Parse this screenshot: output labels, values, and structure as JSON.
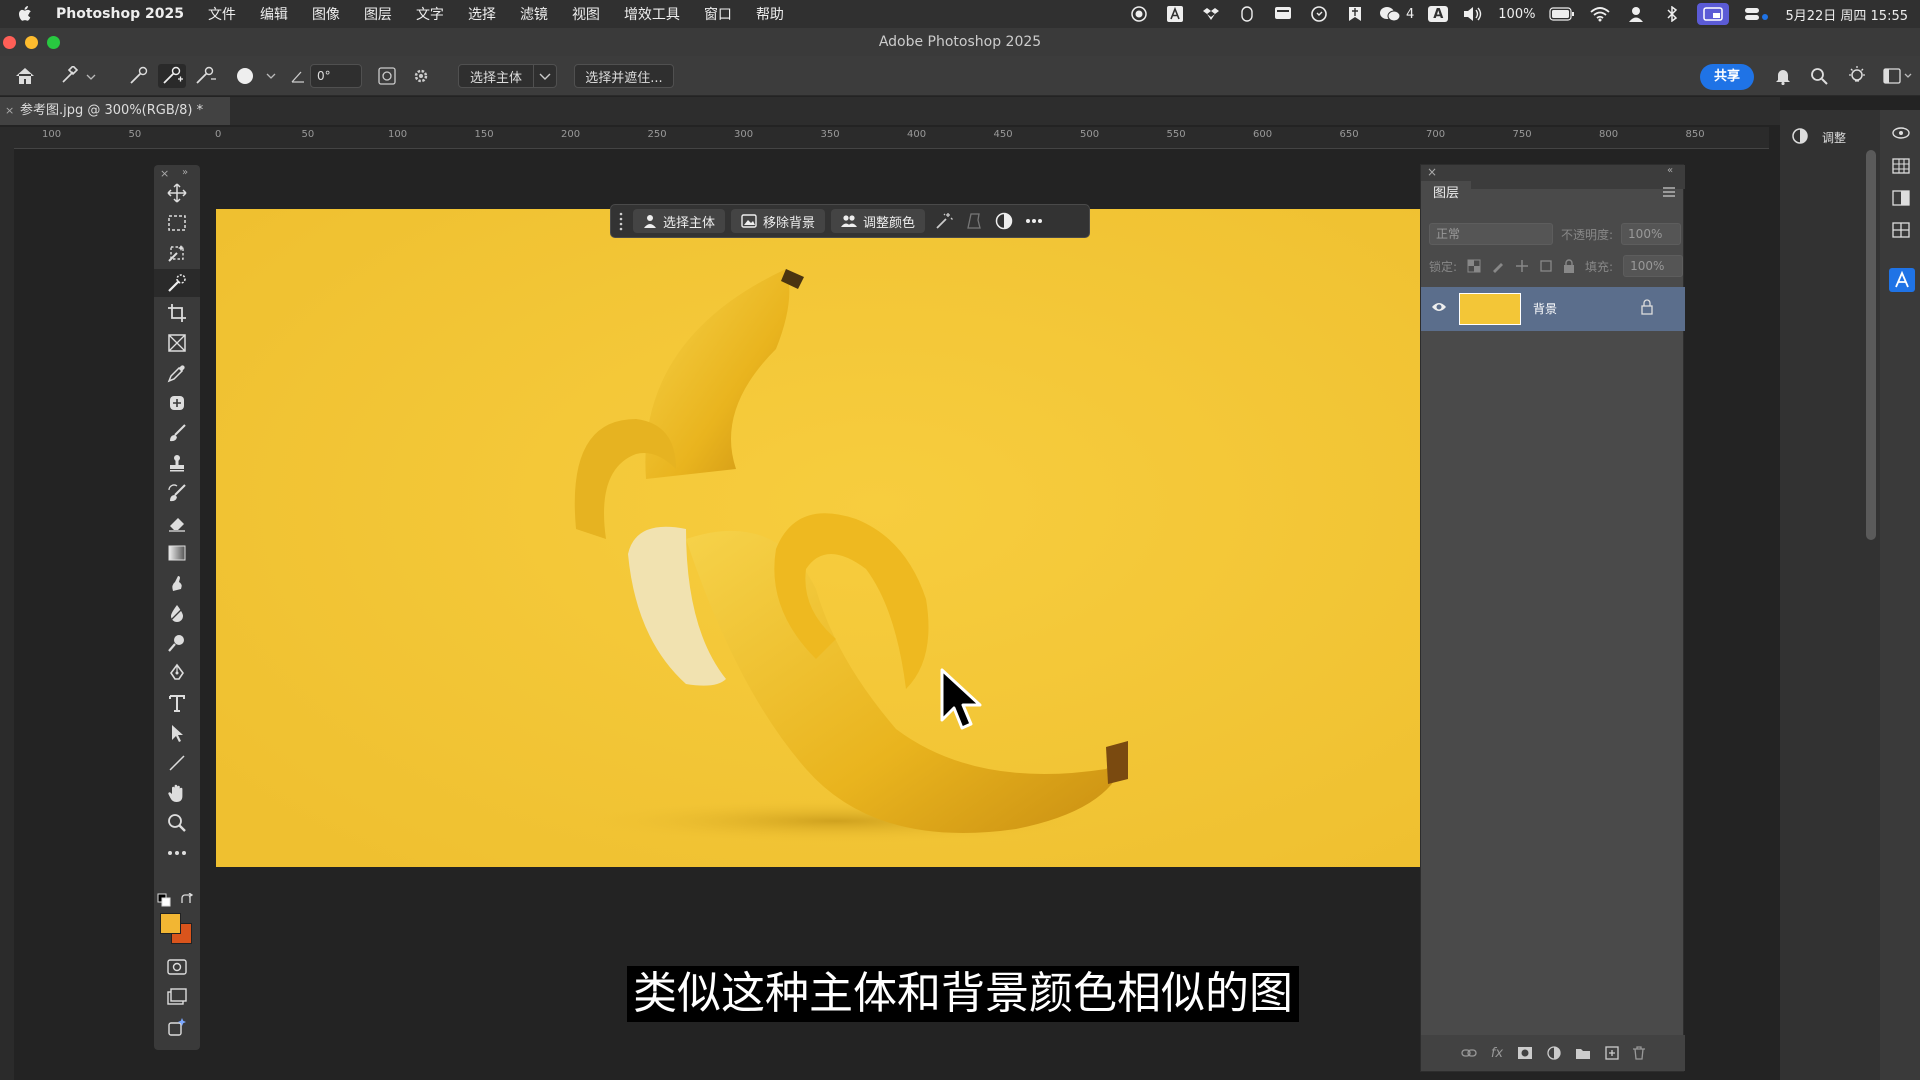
{
  "menubar": {
    "app_name": "Photoshop 2025",
    "items": [
      "文件",
      "编辑",
      "图像",
      "图层",
      "文字",
      "选择",
      "滤镜",
      "视图",
      "增效工具",
      "窗口",
      "帮助"
    ],
    "wechat_count": "4",
    "input_method": "A",
    "battery": "100%",
    "datetime": "5月22日 周四  15:55"
  },
  "window": {
    "title": "Adobe Photoshop 2025"
  },
  "options_bar": {
    "brush_size": "30",
    "angle": "0°",
    "select_subject_label": "选择主体",
    "select_mask_label": "选择并遮住...",
    "share_label": "共享"
  },
  "document": {
    "tab_title": "参考图.jpg @ 300%(RGB/8) *"
  },
  "ruler": {
    "ticks": [
      "100",
      "50",
      "0",
      "50",
      "100",
      "150",
      "200",
      "250",
      "300",
      "350",
      "400",
      "450",
      "500",
      "550",
      "600",
      "650",
      "700",
      "750",
      "800",
      "850"
    ]
  },
  "context_bar": {
    "select_subject": "选择主体",
    "remove_background": "移除背景",
    "adjust_color": "调整颜色"
  },
  "layers_panel": {
    "tab": "图层",
    "blend_mode": "正常",
    "opacity_label": "不透明度:",
    "opacity_value": "100%",
    "lock_label": "锁定:",
    "fill_label": "填充:",
    "fill_value": "100%",
    "layers": [
      {
        "name": "背景",
        "visible": true,
        "locked": true
      }
    ]
  },
  "adjustments_panel": {
    "label": "调整"
  },
  "colors": {
    "foreground": "#f2b633",
    "background": "#d9541c",
    "canvas_bg": "#f3c637",
    "accent": "#1f73e6"
  },
  "subtitle": "类似这种主体和背景颜色相似的图"
}
